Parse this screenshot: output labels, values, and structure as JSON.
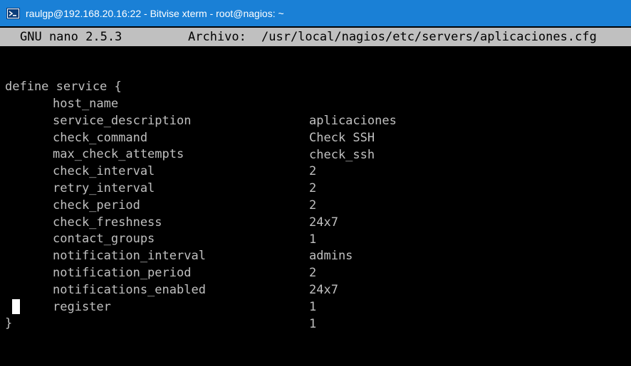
{
  "window": {
    "title": "raulgp@192.168.20.16:22 - Bitvise xterm - root@nagios: ~",
    "icon": "terminal-app-icon",
    "titlebar_color": "#1a80d6"
  },
  "nano": {
    "version": "GNU nano 2.5.3",
    "file_label": "Archivo:",
    "file_path": "/usr/local/nagios/etc/servers/aplicaciones.cfg",
    "header_bg": "#c0c0c0"
  },
  "editor": {
    "open_line": "define service {",
    "close_line": "}",
    "text_color": "#c0c0c0",
    "directives": [
      {
        "name": "host_name",
        "value": "aplicaciones"
      },
      {
        "name": "service_description",
        "value": "Check SSH"
      },
      {
        "name": "check_command",
        "value": "check_ssh"
      },
      {
        "name": "max_check_attempts",
        "value": "2"
      },
      {
        "name": "check_interval",
        "value": "2"
      },
      {
        "name": "retry_interval",
        "value": "2"
      },
      {
        "name": "check_period",
        "value": "24x7"
      },
      {
        "name": "check_freshness",
        "value": "1"
      },
      {
        "name": "contact_groups",
        "value": "admins"
      },
      {
        "name": "notification_interval",
        "value": "2"
      },
      {
        "name": "notification_period",
        "value": "24x7"
      },
      {
        "name": "notifications_enabled",
        "value": "1"
      },
      {
        "name": "register",
        "value": "1"
      }
    ]
  }
}
